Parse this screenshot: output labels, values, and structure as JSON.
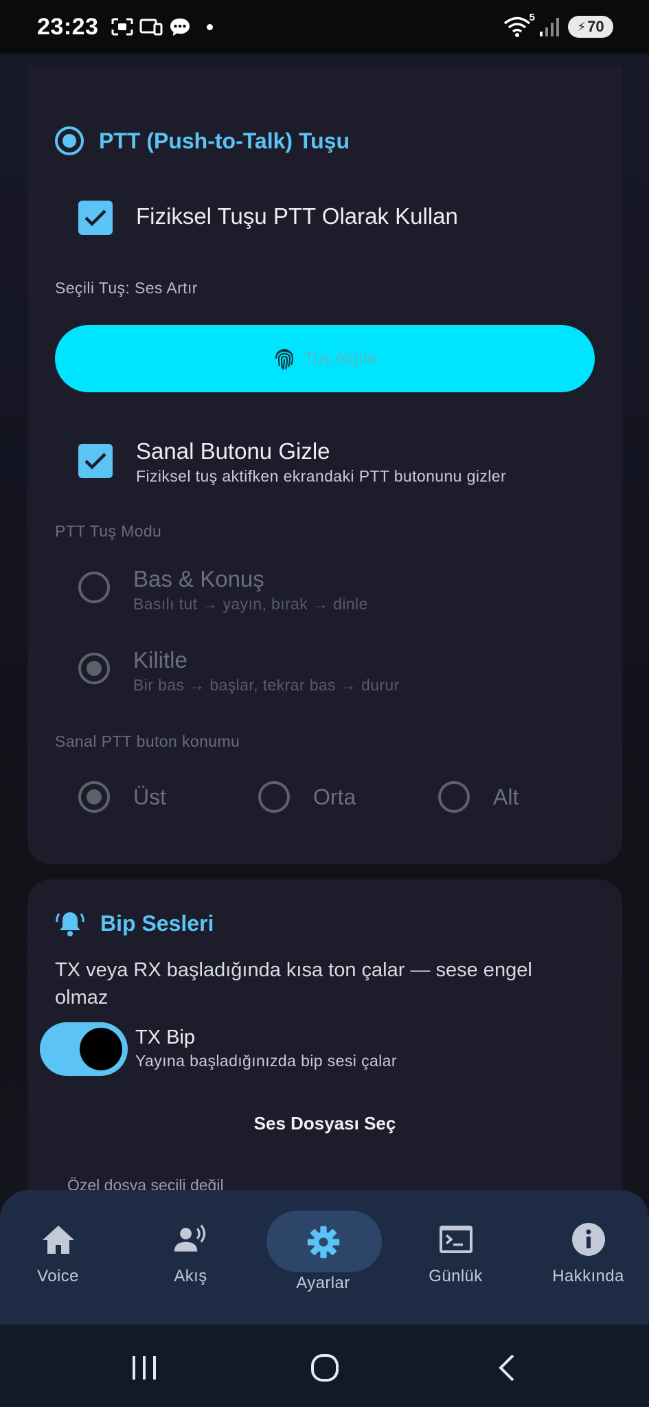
{
  "status_bar": {
    "time": "23:23",
    "wifi_badge": "5",
    "battery": "70"
  },
  "ptt_section": {
    "title": "PTT (Push-to-Talk) Tuşu",
    "use_physical_key": {
      "label": "Fiziksel Tuşu PTT Olarak Kullan",
      "checked": true
    },
    "selected_key_label": "Seçili Tuş: Ses Artır",
    "detect_button_label": "Tuş Algıla",
    "hide_virtual_button": {
      "title": "Sanal Butonu Gizle",
      "subtitle": "Fiziksel tuş aktifken ekrandaki PTT butonunu gizler",
      "checked": true
    },
    "mode_label": "PTT Tuş Modu",
    "modes": [
      {
        "title": "Bas & Konuş",
        "subtitle": "Basılı tut → yayın, bırak → dinle",
        "selected": false
      },
      {
        "title": "Kilitle",
        "subtitle": "Bir bas → başlar, tekrar bas → durur",
        "selected": true
      }
    ],
    "position_label": "Sanal PTT buton konumu",
    "positions": [
      {
        "label": "Üst",
        "selected": true
      },
      {
        "label": "Orta",
        "selected": false
      },
      {
        "label": "Alt",
        "selected": false
      }
    ]
  },
  "beep_section": {
    "title": "Bip Sesleri",
    "description": "TX veya RX başladığında kısa ton çalar — sese engel olmaz",
    "tx_bip": {
      "title": "TX Bip",
      "subtitle": "Yayına başladığınızda bip sesi çalar",
      "enabled": true
    },
    "file_button_label": "Ses Dosyası Seç",
    "file_status": "Özel dosya seçili değil"
  },
  "bottom_nav": {
    "items": [
      {
        "label": "Voice",
        "icon": "home-icon"
      },
      {
        "label": "Akış",
        "icon": "record-voice-icon"
      },
      {
        "label": "Ayarlar",
        "icon": "gear-icon",
        "active": true
      },
      {
        "label": "Günlük",
        "icon": "terminal-icon"
      },
      {
        "label": "Hakkında",
        "icon": "info-icon"
      }
    ]
  },
  "colors": {
    "accent": "#5cc3f5",
    "cyan_button": "#00e5ff",
    "card": "#1c1c2a",
    "nav": "#1d2b45"
  }
}
